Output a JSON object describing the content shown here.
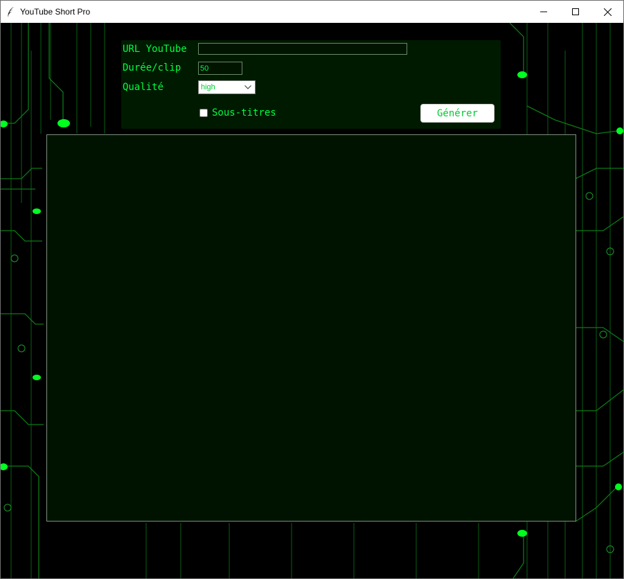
{
  "window": {
    "title": "YouTube Short Pro",
    "minimize_icon": "minimize-icon",
    "maximize_icon": "maximize-icon",
    "close_icon": "close-icon",
    "app_icon": "feather-icon"
  },
  "form": {
    "url_label": "URL YouTube",
    "url_value": "",
    "duree_label": "Durée/clip",
    "duree_value": "50",
    "qualite_label": "Qualité",
    "qualite_selected": "high",
    "sous_titres_label": "Sous-titres",
    "sous_titres_checked": false,
    "generate_label": "Générer"
  },
  "output": {
    "text": ""
  },
  "colors": {
    "accent": "#00ff41",
    "panel": "#001a00",
    "output_bg": "#001300",
    "background": "#000000"
  }
}
